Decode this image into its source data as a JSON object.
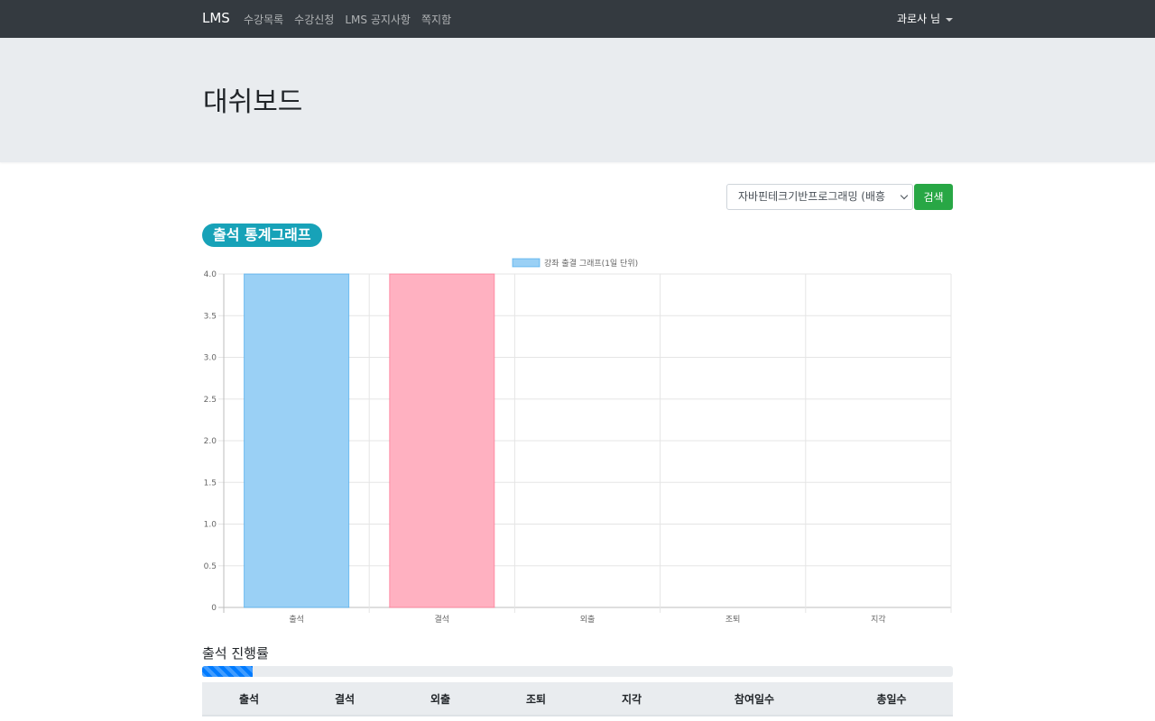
{
  "navbar": {
    "brand": "LMS",
    "links": [
      "수강목록",
      "수강신청",
      "LMS 공지사항",
      "쪽지함"
    ],
    "user": "과로사 님"
  },
  "header": {
    "title": "대쉬보드"
  },
  "search": {
    "selected_course": "자바핀테크기반프로그래밍 (배흥",
    "button_label": "검색"
  },
  "section": {
    "badge": "출석 통계그래프"
  },
  "colors": {
    "nav_bg": "#343a40",
    "jumbotron_bg": "#e9ecef",
    "search_button": "#28a745",
    "badge": "#17a2b8",
    "progress": "#007bff"
  },
  "chart_data": {
    "type": "bar",
    "categories": [
      "출석",
      "결석",
      "외출",
      "조퇴",
      "지각"
    ],
    "series": [
      {
        "name": "강좌 출결 그래프(1일 단위)",
        "values": [
          4,
          4,
          0,
          0,
          0
        ]
      }
    ],
    "bar_colors": [
      "#9ad0f5",
      "#ffb1c1",
      "#ffe6aa",
      "#a5dfdf",
      "#ccb2ff"
    ],
    "bar_borders": [
      "#36a2eb",
      "#ff6384",
      "#ffcd56",
      "#4bc0c0",
      "#9966ff"
    ],
    "ylim": [
      0,
      4
    ],
    "yticks": [
      "0",
      "0.5",
      "1.0",
      "1.5",
      "2.0",
      "2.5",
      "3.0",
      "3.5",
      "4.0"
    ],
    "grid": true,
    "legend": "top-center"
  },
  "progress": {
    "title": "출석 진행률",
    "percent": 6.7
  },
  "table": {
    "headers": [
      "출석",
      "결석",
      "외출",
      "조퇴",
      "지각",
      "참여일수",
      "총일수"
    ]
  }
}
